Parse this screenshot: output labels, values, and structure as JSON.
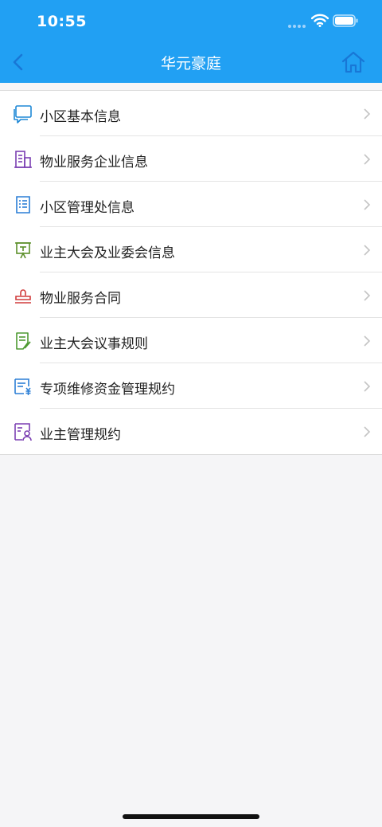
{
  "status_bar": {
    "time": "10:55",
    "icons": [
      "signal-icon",
      "wifi-icon",
      "battery-icon"
    ]
  },
  "nav": {
    "title": "华元豪庭",
    "back_icon": "chevron-left-icon",
    "home_icon": "home-icon"
  },
  "colors": {
    "header": "#21a0f3",
    "background": "#f5f5f7",
    "list_bg": "#ffffff",
    "divider": "#e4e4e4",
    "chevron": "#c4c4c4"
  },
  "menu": {
    "items": [
      {
        "label": "小区基本信息",
        "icon": "chat-bubble-icon",
        "color": "#1e88d6"
      },
      {
        "label": "物业服务企业信息",
        "icon": "building-icon",
        "color": "#7b3fb2"
      },
      {
        "label": "小区管理处信息",
        "icon": "document-list-icon",
        "color": "#2b7fd6"
      },
      {
        "label": "业主大会及业委会信息",
        "icon": "presentation-board-icon",
        "color": "#5c8f2a"
      },
      {
        "label": "物业服务合同",
        "icon": "stamp-icon",
        "color": "#d13b3b"
      },
      {
        "label": "业主大会议事规则",
        "icon": "edit-document-icon",
        "color": "#4e9a32"
      },
      {
        "label": "专项维修资金管理规约",
        "icon": "fund-document-icon",
        "color": "#2b7fd6"
      },
      {
        "label": "业主管理规约",
        "icon": "owner-profile-icon",
        "color": "#7b3fb2"
      }
    ]
  }
}
